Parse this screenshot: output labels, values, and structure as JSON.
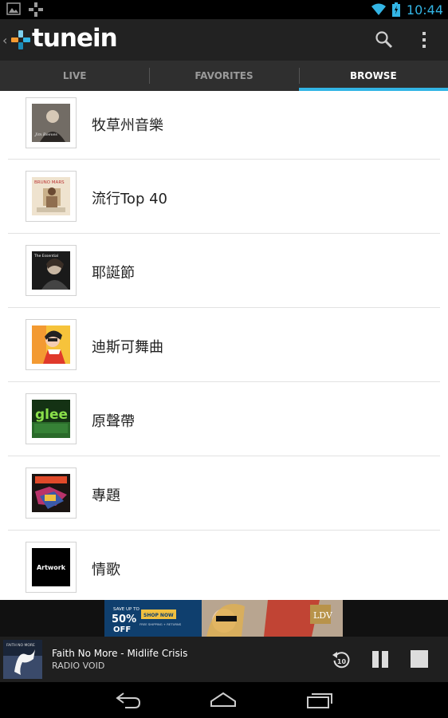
{
  "status_bar": {
    "time": "10:44",
    "notification_icons": [
      "image-icon",
      "tunein-icon"
    ],
    "system_icons": [
      "wifi-icon",
      "battery-icon"
    ]
  },
  "app": {
    "name": "tunein",
    "brand_color": "#33b5e5"
  },
  "action_bar": {
    "icons": [
      "back-chevron-icon",
      "search-icon",
      "overflow-menu-icon"
    ]
  },
  "tabs": [
    {
      "label": "LIVE",
      "active": false
    },
    {
      "label": "FAVORITES",
      "active": false
    },
    {
      "label": "BROWSE",
      "active": true
    }
  ],
  "list": {
    "items": [
      {
        "label": "牧草州音樂",
        "art_text": ""
      },
      {
        "label": "流行Top 40",
        "art_text": "BRUNO MARS"
      },
      {
        "label": "耶誕節",
        "art_text": "The Essential"
      },
      {
        "label": "迪斯可舞曲",
        "art_text": ""
      },
      {
        "label": "原聲帶",
        "art_text": "glee"
      },
      {
        "label": "專題",
        "art_text": ""
      },
      {
        "label": "情歌",
        "art_text": "Artwork"
      }
    ]
  },
  "ad": {
    "line1": "SAVE UP TO",
    "percent": "50%",
    "off": "OFF",
    "cta": "SHOP NOW",
    "fine_print": "FREE SHIPPING + RETURNS",
    "brand": "LDV"
  },
  "now_playing": {
    "title": "Faith No More - Midlife Crisis",
    "station": "RADIO VOID",
    "album_art_text": "FAITH NO MORE",
    "rewind_label": "10",
    "controls": [
      "rewind-10-icon",
      "pause-icon",
      "stop-icon"
    ]
  },
  "nav_bar": {
    "icons": [
      "back-icon",
      "home-icon",
      "recent-apps-icon"
    ]
  }
}
